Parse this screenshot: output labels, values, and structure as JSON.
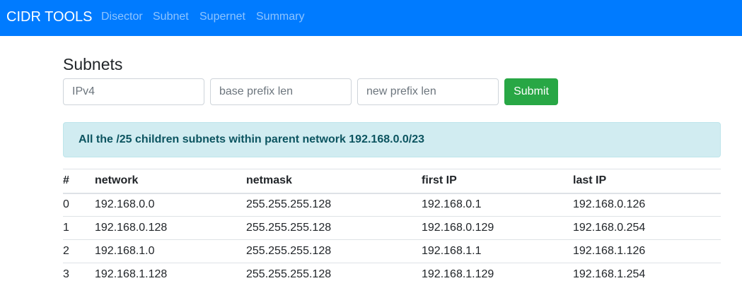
{
  "navbar": {
    "brand": "CIDR TOOLS",
    "links": [
      "Disector",
      "Subnet",
      "Supernet",
      "Summary"
    ],
    "background_color": "#007bff"
  },
  "main": {
    "title": "Subnets",
    "inputs": {
      "ipv4_placeholder": "IPv4",
      "base_prefix_placeholder": "base prefix len",
      "new_prefix_placeholder": "new prefix len"
    },
    "submit_label": "Submit",
    "alert_text": "All the /25 children subnets within parent network 192.168.0.0/23",
    "table": {
      "headers": [
        "#",
        "network",
        "netmask",
        "first IP",
        "last IP"
      ],
      "rows": [
        [
          "0",
          "192.168.0.0",
          "255.255.255.128",
          "192.168.0.1",
          "192.168.0.126"
        ],
        [
          "1",
          "192.168.0.128",
          "255.255.255.128",
          "192.168.0.129",
          "192.168.0.254"
        ],
        [
          "2",
          "192.168.1.0",
          "255.255.255.128",
          "192.168.1.1",
          "192.168.1.126"
        ],
        [
          "3",
          "192.168.1.128",
          "255.255.255.128",
          "192.168.1.129",
          "192.168.1.254"
        ]
      ]
    }
  },
  "colors": {
    "primary": "#007bff",
    "success": "#28a745",
    "info_bg": "#d1ecf1",
    "info_text": "#0c5460"
  }
}
